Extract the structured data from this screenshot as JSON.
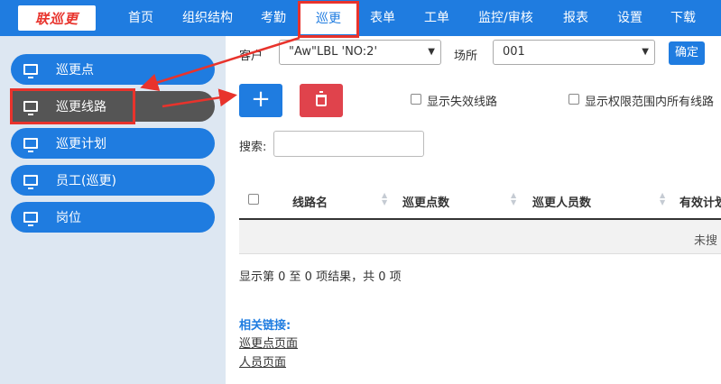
{
  "header": {
    "logo_text": "联巡更",
    "nav": [
      {
        "label": "首页"
      },
      {
        "label": "组织结构"
      },
      {
        "label": "考勤"
      },
      {
        "label": "巡更"
      },
      {
        "label": "表单"
      },
      {
        "label": "工单"
      },
      {
        "label": "监控/审核"
      },
      {
        "label": "报表"
      },
      {
        "label": "设置"
      },
      {
        "label": "下载"
      }
    ],
    "active_nav": "巡更"
  },
  "sidebar": {
    "items": [
      {
        "label": "巡更点",
        "icon": "monitor-icon"
      },
      {
        "label": "巡更线路",
        "icon": "monitor-icon"
      },
      {
        "label": "巡更计划",
        "icon": "monitor-icon"
      },
      {
        "label": "员工(巡更)",
        "icon": "monitor-icon"
      },
      {
        "label": "岗位",
        "icon": "monitor-icon"
      }
    ],
    "active_item": "巡更线路"
  },
  "filters": {
    "customer_label": "客户",
    "customer_value": "\"Aw\"LBL  'NO:2'",
    "site_label": "场所",
    "site_value": "001",
    "confirm_label": "确定"
  },
  "toolbar": {
    "add_label": "+",
    "show_invalid_label": "显示失效线路",
    "show_all_label": "显示权限范围内所有线路"
  },
  "search": {
    "label": "搜索:",
    "value": ""
  },
  "table": {
    "columns": [
      "线路名",
      "巡更点数",
      "巡更人员数",
      "有效计划"
    ],
    "empty_text": "未搜",
    "info": "显示第 0 至 0 项结果，共 0 项"
  },
  "related": {
    "title": "相关链接:",
    "links": [
      "巡更点页面",
      "人员页面"
    ]
  },
  "colors": {
    "primary": "#1f7ce0",
    "danger": "#e0434c",
    "annotation": "#e8332c",
    "sidebar_bg": "#dde7f2"
  }
}
